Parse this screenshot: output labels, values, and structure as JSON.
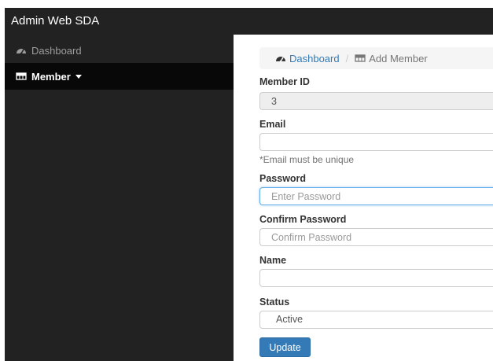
{
  "app": {
    "title": "Admin Web SDA"
  },
  "sidebar": {
    "items": [
      {
        "label": "Dashboard",
        "icon": "dashboard-icon"
      },
      {
        "label": "Member",
        "icon": "table-icon"
      }
    ]
  },
  "breadcrumb": {
    "items": [
      {
        "label": "Dashboard",
        "icon": "dashboard-icon"
      },
      {
        "label": "Add Member",
        "icon": "table-icon"
      }
    ],
    "separator": "/"
  },
  "form": {
    "member_id": {
      "label": "Member ID",
      "value": "3"
    },
    "email": {
      "label": "Email",
      "value": "",
      "help": "*Email must be unique"
    },
    "password": {
      "label": "Password",
      "placeholder": "Enter Password"
    },
    "confirm_password": {
      "label": "Confirm Password",
      "placeholder": "Confirm Password"
    },
    "name": {
      "label": "Name",
      "value": ""
    },
    "status": {
      "label": "Status",
      "selected": "Active"
    },
    "submit_label": "Update"
  },
  "colors": {
    "navbar": "#222222",
    "active_item": "#080808",
    "link": "#337ab7",
    "primary_button": "#337ab7",
    "focus_border": "#66afe9"
  }
}
